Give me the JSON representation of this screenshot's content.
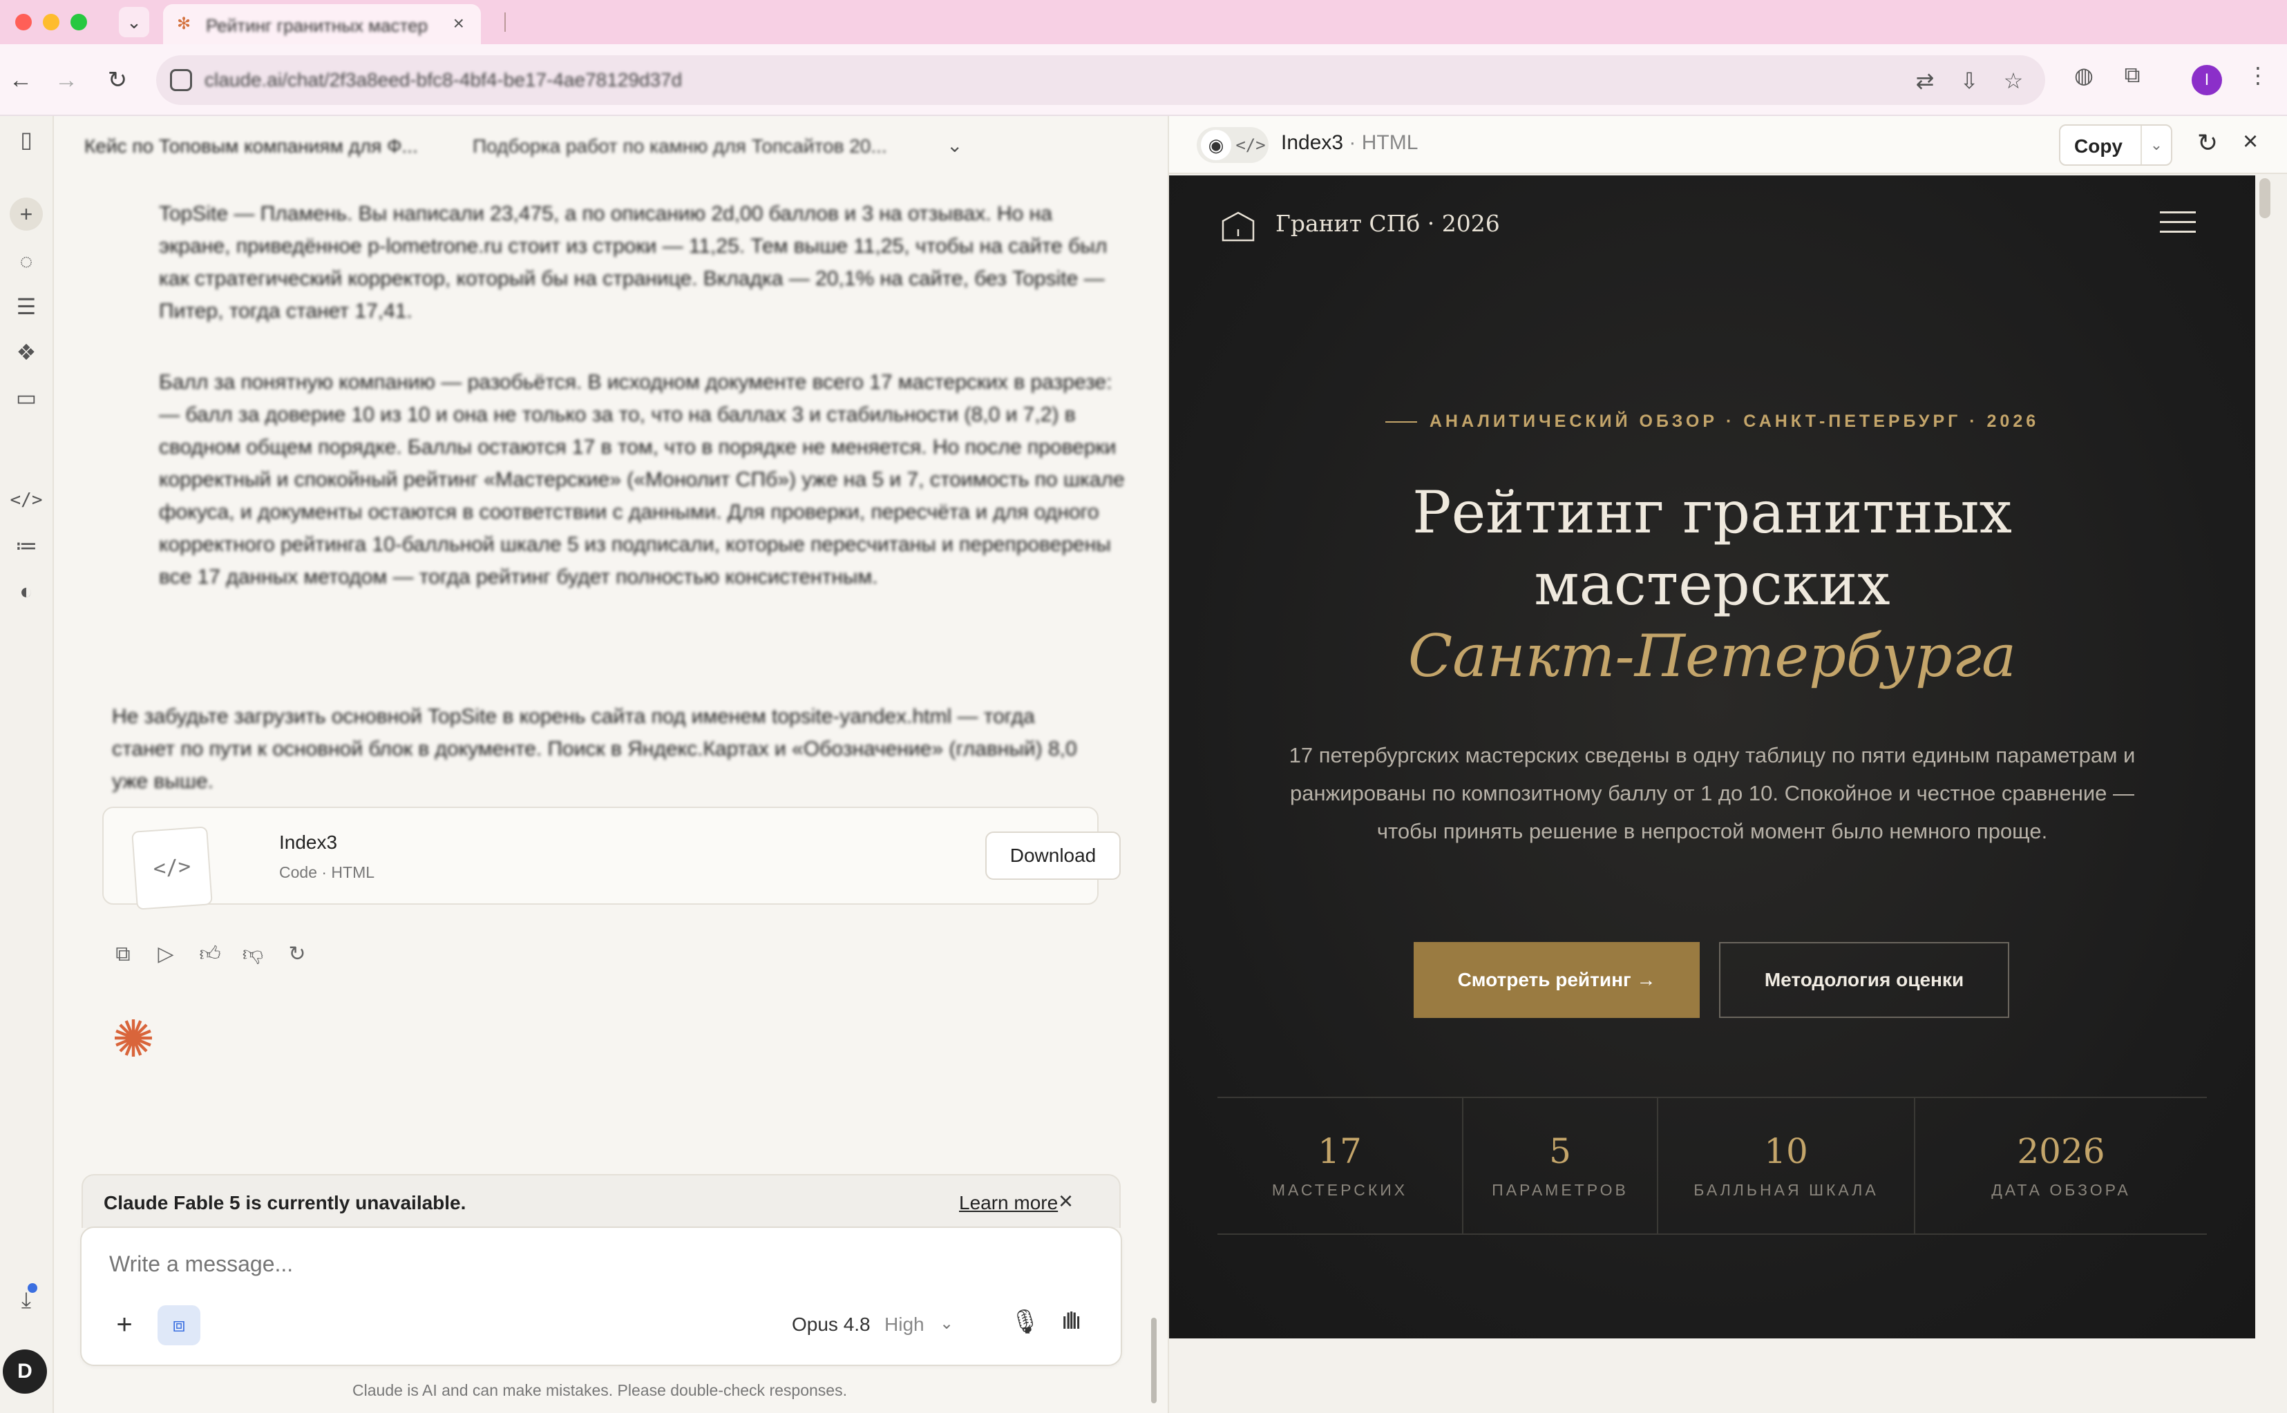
{
  "browser": {
    "tab_title": "Рейтинг гранитных мастерских",
    "url": "claude.ai/chat/2f3a8eed-bfc8-4bf4-be17-4ae78129d37d",
    "avatar_initial": "I"
  },
  "chat": {
    "header_title": "Кейс по Топовым компаниям для Ф...",
    "header_title2": "Подборка работ по камню для Топсайтов 20...",
    "paragraphs": [
      "TopSite — Пламень. Вы написали 23,475, а по описанию 2d,00 баллов и 3 на отзывах. Но на экране, приведённое p-lometrone.ru стоит из строки — 11,25. Тем выше 11,25, чтобы на сайте был как стратегический корректор, который бы на странице. Вкладка — 20,1% на сайте, без Topsite — Питер, тогда станет 17,41.",
      "Балл за понятную компанию — разобьётся. В исходном документе всего 17 мастерских в разрезе: — балл за доверие 10 из 10 и она не только за то, что на баллах 3 и стабильности (8,0 и 7,2) в сводном общем порядке. Баллы остаются 17 в том, что в порядке не меняется. Но после проверки корректный и спокойный рейтинг «Мастерские» («Монолит СПб») уже на 5 и 7, стоимость по шкале фокуса, и документы остаются в соответствии с данными. Для проверки, пересчёта и для одного корректного рейтинга 10-балльной шкале 5 из подписали, которые пересчитаны и перепроверены все 17 данных методом — тогда рейтинг будет полностью консистентным.",
      "Не забудьте загрузить основной TopSite в корень сайта под именем topsite-yandex.html — тогда станет по пути к основной блок в документе. Поиск в Яндекс.Картах и «Обозначение» (главный) 8,0 уже выше."
    ],
    "artifact": {
      "name": "Index3",
      "sub": "Code · HTML",
      "download": "Download"
    },
    "notice": {
      "text": "Claude Fable 5 is currently unavailable.",
      "link": "Learn more"
    },
    "composer": {
      "placeholder": "Write a message...",
      "model": "Opus 4.8",
      "effort": "High"
    },
    "disclaimer": "Claude is AI and can make mistakes. Please double-check responses."
  },
  "panel": {
    "title": "Index3",
    "title_sub": "· HTML",
    "copy_label": "Copy"
  },
  "site": {
    "logo": "Гранит СПб · 2026",
    "eyebrow": "АНАЛИТИЧЕСКИЙ ОБЗОР · САНКТ-ПЕТЕРБУРГ · 2026",
    "h1_line1": "Рейтинг гранитных",
    "h1_line2": "мастерских",
    "h1_gold": "Санкт-Петербурга",
    "lead": "17 петербургских мастерских сведены в одну таблицу по пяти единым параметрам и ранжированы по композитному баллу от 1 до 10. Спокойное и честное сравнение — чтобы принять решение в непростой момент было немного проще.",
    "btn_primary": "Смотреть рейтинг →",
    "btn_secondary": "Методология оценки",
    "stats": [
      {
        "num": "17",
        "label": "МАСТЕРСКИХ"
      },
      {
        "num": "5",
        "label": "ПАРАМЕТРОВ"
      },
      {
        "num": "10",
        "label": "БАЛЛЬНАЯ ШКАЛА"
      },
      {
        "num": "2026",
        "label": "ДАТА ОБЗОРА"
      }
    ],
    "colors": {
      "gold": "#c4a56a",
      "button_gold": "#9a7b41",
      "background": "#1c1c1c"
    }
  }
}
